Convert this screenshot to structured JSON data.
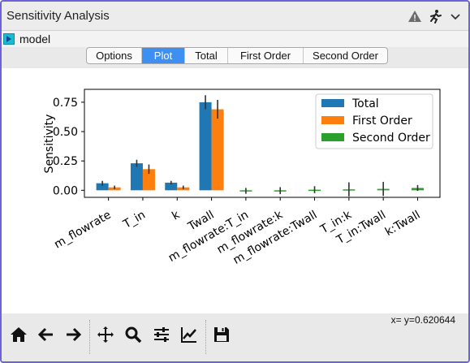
{
  "window": {
    "title": "Sensitivity Analysis"
  },
  "titlebar_icons": [
    "warning-icon",
    "run-icon",
    "chevron-down-icon"
  ],
  "model": {
    "label": "model"
  },
  "tabs": [
    {
      "label": "Options",
      "active": false
    },
    {
      "label": "Plot",
      "active": true
    },
    {
      "label": "Total",
      "active": false
    },
    {
      "label": "First Order",
      "active": false
    },
    {
      "label": "Second Order",
      "active": false
    }
  ],
  "toolbar": {
    "tools": [
      "home-icon",
      "back-icon",
      "forward-icon",
      "pan-icon",
      "zoom-icon",
      "configure-subplots-icon",
      "edit-axis-icon",
      "save-icon"
    ],
    "coords": "x= y=0.620644"
  },
  "colors": {
    "total": "#1f77b4",
    "first": "#ff7f0e",
    "second": "#2ca02c",
    "accent": "#3d8ff2"
  },
  "chart_data": {
    "type": "bar",
    "ylabel": "Sensitivity",
    "xlabel": "",
    "categories": [
      "m_flowrate",
      "T_in",
      "k",
      "Twall",
      "m_flowrate:T_in",
      "m_flowrate:k",
      "m_flowrate:Twall",
      "T_in:k",
      "T_in:Twall",
      "k:Twall"
    ],
    "yticks": [
      "0.00",
      "0.25",
      "0.50",
      "0.75"
    ],
    "ylim": [
      -0.06,
      0.86
    ],
    "legend_position": "top-right",
    "series": [
      {
        "name": "Total",
        "values": [
          0.06,
          0.23,
          0.065,
          0.75,
          null,
          null,
          null,
          null,
          null,
          null
        ],
        "errors": [
          0.02,
          0.03,
          0.015,
          0.06,
          null,
          null,
          null,
          null,
          null,
          null
        ]
      },
      {
        "name": "First Order",
        "values": [
          0.025,
          0.18,
          0.025,
          0.69,
          null,
          null,
          null,
          null,
          null,
          null
        ],
        "errors": [
          0.015,
          0.04,
          0.015,
          0.08,
          null,
          null,
          null,
          null,
          null,
          null
        ]
      },
      {
        "name": "Second Order",
        "values": [
          null,
          null,
          null,
          null,
          -0.005,
          -0.003,
          0.005,
          0.008,
          0.012,
          0.02
        ],
        "errors": [
          null,
          null,
          null,
          null,
          0.025,
          0.03,
          0.03,
          0.06,
          0.06,
          0.025
        ]
      }
    ]
  }
}
